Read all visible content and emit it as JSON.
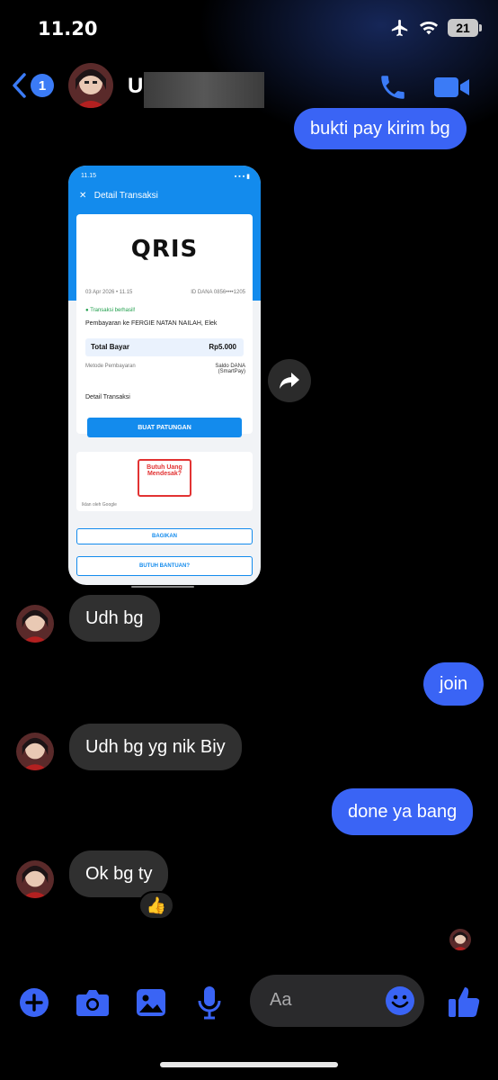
{
  "status_bar": {
    "time": "11.20",
    "battery": "21"
  },
  "header": {
    "unread_count": "1",
    "contact_initial": "U"
  },
  "messages": [
    {
      "type": "sent",
      "text": "bukti pay kirim bg"
    },
    {
      "type": "received",
      "text": "Udh bg"
    },
    {
      "type": "sent",
      "text": "join"
    },
    {
      "type": "received",
      "text": "Udh bg yg nik Biy"
    },
    {
      "type": "sent",
      "text": "done ya bang"
    },
    {
      "type": "received",
      "text": "Ok bg ty",
      "reaction": "👍"
    }
  ],
  "screenshot": {
    "status_time": "11.15",
    "title": "Detail Transaksi",
    "logo_text": "QRIS",
    "date": "03 Apr 2026 • 11.15",
    "dana_id": "ID DANA 0856••••1205",
    "status": "Transaksi berhasil!",
    "payment_to": "Pembayaran ke FERGIE NATAN NAILAH, Elek",
    "total_label": "Total Bayar",
    "total_value": "Rp5.000",
    "method_label": "Metode Pembayaran",
    "method_value": "Saldo DANA (SmartPay)",
    "detail_label": "Detail Transaksi",
    "patungan_button": "BUAT PATUNGAN",
    "ad_title": "Butuh Uang Mendesak?",
    "ad_by": "Iklan oleh Google",
    "share_button": "BAGIKAN",
    "help_button": "BUTUH BANTUAN?"
  },
  "composer": {
    "placeholder": "Aa"
  },
  "colors": {
    "accent": "#3a64f5",
    "incoming": "#303030",
    "dana_blue": "#138bed"
  }
}
